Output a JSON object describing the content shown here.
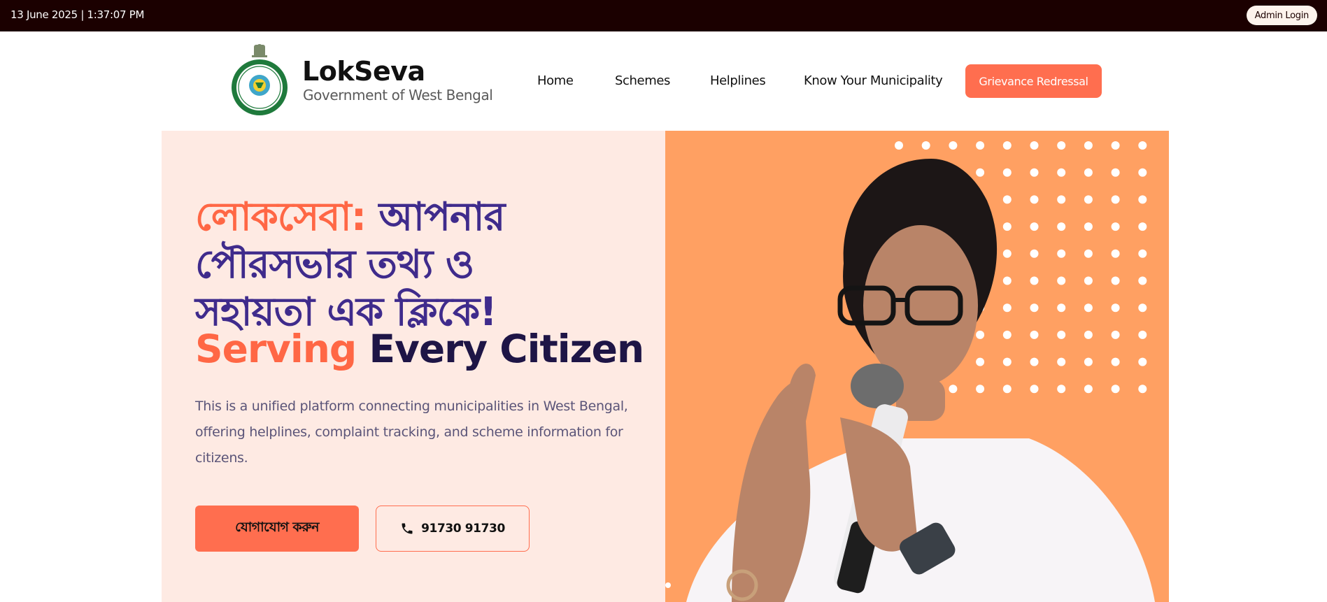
{
  "topbar": {
    "datetime": "13 June 2025  |  1:37:07 PM",
    "admin_login": "Admin Login"
  },
  "brand": {
    "name": "LokSeva",
    "subtitle": "Government of West Bengal",
    "emblem_icon": "west-bengal-emblem"
  },
  "nav": {
    "items": [
      "Home",
      "Schemes",
      "Helplines",
      "Know Your Municipality"
    ],
    "cta": "Grievance Redressal"
  },
  "hero": {
    "headline_bn_accent": "লোকসেবা:",
    "headline_bn_1": "আপনার",
    "headline_bn_2": "পৌরসভার তথ্য ও",
    "headline_bn_3": "সহায়তা এক ক্লিকে!",
    "headline_en_accent": "Serving",
    "headline_en_rest": "Every Citizen",
    "description_lines": [
      "This is a unified platform connecting municipalities in West Bengal,",
      "offering helplines, complaint tracking, and scheme information for",
      "citizens."
    ],
    "contact_button": "যোগাযোগ করুন",
    "phone_button": "91730 91730",
    "phone_icon": "phone-icon"
  },
  "colors": {
    "topbar_bg": "#1b0000",
    "accent": "#ff6e4f",
    "hero_left_bg": "#feeae3",
    "hero_right_bg": "#ffa062",
    "headline_purple": "#3f2b8c",
    "headline_dark": "#1e1546"
  }
}
